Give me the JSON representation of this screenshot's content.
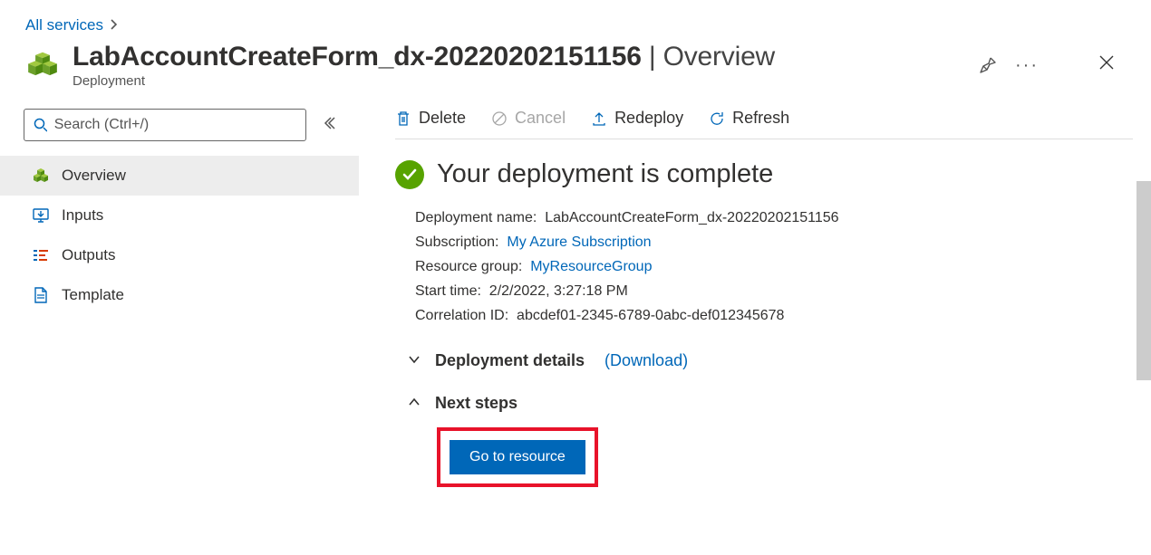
{
  "breadcrumb": {
    "all_services": "All services"
  },
  "header": {
    "title": "LabAccountCreateForm_dx-20220202151156",
    "title_suffix": " | Overview",
    "subtitle": "Deployment"
  },
  "sidebar": {
    "search_placeholder": "Search (Ctrl+/)",
    "items": [
      {
        "label": "Overview",
        "icon": "cubes"
      },
      {
        "label": "Inputs",
        "icon": "monitor-down"
      },
      {
        "label": "Outputs",
        "icon": "list-bars"
      },
      {
        "label": "Template",
        "icon": "document"
      }
    ]
  },
  "toolbar": {
    "delete": "Delete",
    "cancel": "Cancel",
    "redeploy": "Redeploy",
    "refresh": "Refresh"
  },
  "status": {
    "title": "Your deployment is complete"
  },
  "details": {
    "deployment_name_label": "Deployment name:",
    "deployment_name": "LabAccountCreateForm_dx-20220202151156",
    "subscription_label": "Subscription:",
    "subscription": "My Azure Subscription",
    "resource_group_label": "Resource group:",
    "resource_group": "MyResourceGroup",
    "start_time_label": "Start time:",
    "start_time": "2/2/2022, 3:27:18 PM",
    "correlation_id_label": "Correlation ID:",
    "correlation_id": "abcdef01-2345-6789-0abc-def012345678"
  },
  "sections": {
    "deployment_details": "Deployment details",
    "download": "(Download)",
    "next_steps": "Next steps"
  },
  "buttons": {
    "go_to_resource": "Go to resource"
  }
}
